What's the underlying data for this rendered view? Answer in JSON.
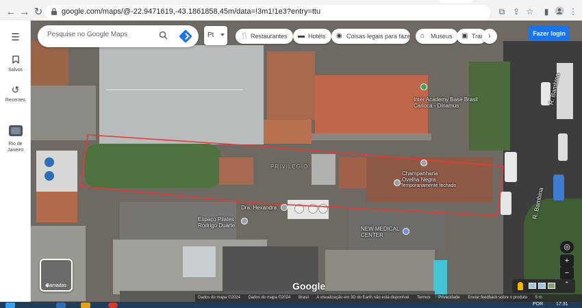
{
  "browser": {
    "url": "google.com/maps/@-22.9471619,-43.1861858,45m/data=!3m1!1e3?entry=ttu",
    "back_icon": "arrow-left-icon",
    "forward_icon": "arrow-right-icon",
    "reload_icon": "reload-icon"
  },
  "rail": {
    "menu_icon": "hamburger-icon",
    "items": [
      {
        "label": "Salvos",
        "icon": "bookmark-icon"
      },
      {
        "label": "Recentes",
        "icon": "history-icon"
      },
      {
        "label": "Rio de Janeiro",
        "icon": "place-thumbnail"
      }
    ]
  },
  "search": {
    "placeholder": "Pesquise no Google Maps"
  },
  "language": {
    "value": "Pt"
  },
  "chips": [
    {
      "label": "Restaurantes",
      "icon": "fork-knife-icon"
    },
    {
      "label": "Hotéis",
      "icon": "bed-icon"
    },
    {
      "label": "Coisas legais para fazer",
      "icon": "camera-icon"
    },
    {
      "label": "Museus",
      "icon": "museum-icon"
    },
    {
      "label": "Tran",
      "icon": "transit-icon"
    }
  ],
  "login_label": "Fazer login",
  "map": {
    "places": [
      {
        "label": "Inter Academy Base Brasil Carioca - Dinamus",
        "color": "#34a853"
      },
      {
        "label": "Champanharia Ovelha Negra",
        "sublabel": "Temporariamente fechado",
        "color": "#9aa0a6"
      },
      {
        "label": "Dra. Hexandra",
        "color": "#9aa0a6"
      },
      {
        "label": "Espaço Pilates Rodrigo Duarte",
        "color": "#9aa0a6"
      },
      {
        "label": "NEW MEDICAL CENTER",
        "color": "#7b8ce0"
      }
    ],
    "streets": [
      "R. Bambina",
      "R. Bambina"
    ],
    "watermark": "PRIVILEGIO",
    "logo": "Google"
  },
  "controls": {
    "layers_label": "Camadas",
    "zoom_in": "+",
    "zoom_out": "−"
  },
  "footer": {
    "items": [
      "Dados do mapa ©2024",
      "Dados do mapa ©2024",
      "Brasil",
      "A visualização em 3D do Earth não está disponível",
      "Termos",
      "Privacidade",
      "Enviar feedback sobre o produto",
      "5 m"
    ]
  },
  "taskbar": {
    "lang": "POR",
    "time": "17:31"
  },
  "colors": {
    "accent": "#1a73e8",
    "parcel_outline": "#e53935"
  }
}
